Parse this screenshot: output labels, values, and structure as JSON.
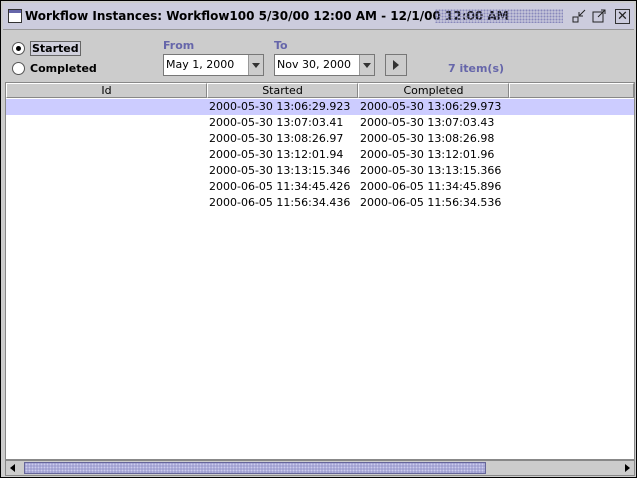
{
  "window": {
    "title": "Workflow Instances: Workflow100 5/30/00 12:00 AM - 12/1/00 12:00 AM",
    "icons": [
      "window-icon",
      "minimize-icon",
      "maximize-icon",
      "close-icon"
    ]
  },
  "filter": {
    "options": [
      {
        "label": "Started",
        "selected": true
      },
      {
        "label": "Completed",
        "selected": false
      }
    ],
    "from_label": "From",
    "from_value": "May 1, 2000",
    "to_label": "To",
    "to_value": "Nov 30, 2000",
    "count_text": "7  item(s)"
  },
  "table": {
    "columns": [
      "Id",
      "Started",
      "Completed"
    ],
    "rows": [
      {
        "id": "",
        "started": "2000-05-30 13:06:29.923",
        "completed": "2000-05-30 13:06:29.973",
        "selected": true
      },
      {
        "id": "",
        "started": "2000-05-30 13:07:03.41",
        "completed": "2000-05-30 13:07:03.43",
        "selected": false
      },
      {
        "id": "",
        "started": "2000-05-30 13:08:26.97",
        "completed": "2000-05-30 13:08:26.98",
        "selected": false
      },
      {
        "id": "",
        "started": "2000-05-30 13:12:01.94",
        "completed": "2000-05-30 13:12:01.96",
        "selected": false
      },
      {
        "id": "",
        "started": "2000-05-30 13:13:15.346",
        "completed": "2000-05-30 13:13:15.366",
        "selected": false
      },
      {
        "id": "",
        "started": "2000-06-05 11:34:45.426",
        "completed": "2000-06-05 11:34:45.896",
        "selected": false
      },
      {
        "id": "",
        "started": "2000-06-05 11:56:34.436",
        "completed": "2000-06-05 11:56:34.536",
        "selected": false
      }
    ]
  },
  "colors": {
    "accent": "#6666aa",
    "selection": "#ccccff",
    "titlebar": "#ccccdd"
  }
}
